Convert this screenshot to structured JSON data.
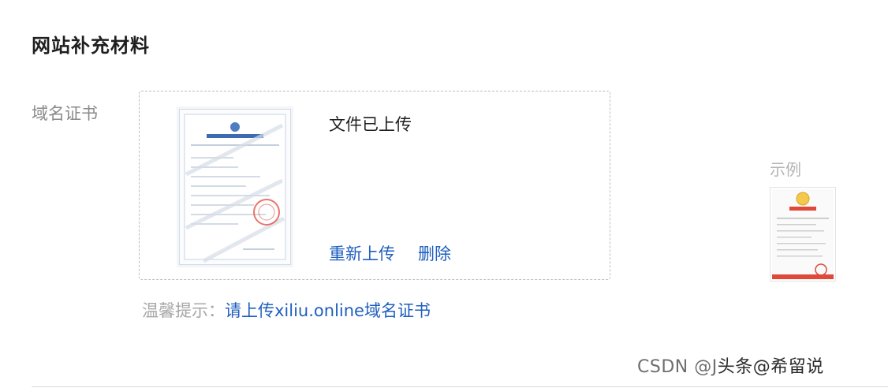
{
  "section": {
    "title": "网站补充材料"
  },
  "domain_certificate": {
    "label": "域名证书",
    "upload_status": "文件已上传",
    "reupload_label": "重新上传",
    "delete_label": "删除"
  },
  "hint": {
    "label": "温馨提示：",
    "text": "请上传xiliu.online域名证书"
  },
  "example": {
    "label": "示例"
  },
  "watermark": {
    "prefix": "CSDN @J",
    "accent": "头条@希留说"
  },
  "colors": {
    "link": "#1f5fbf",
    "dashed_border": "#b9bec6",
    "stamp_red": "#e0483a"
  }
}
